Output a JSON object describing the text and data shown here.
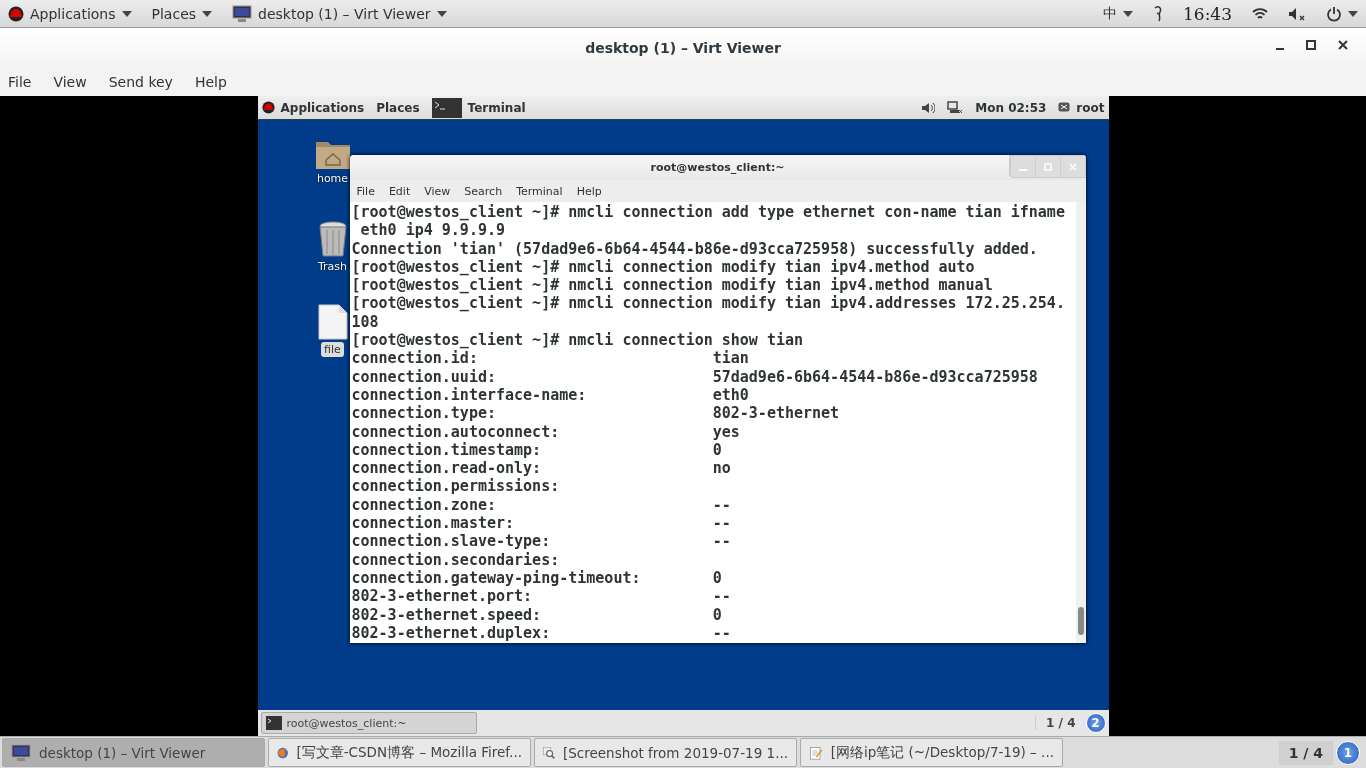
{
  "host_top_bar": {
    "applications": "Applications",
    "places": "Places",
    "active_app": "desktop (1) – Virt Viewer",
    "input_method": "中",
    "clock": "16:43"
  },
  "window": {
    "title": "desktop (1) – Virt Viewer",
    "menu": [
      "File",
      "View",
      "Send key",
      "Help"
    ]
  },
  "guest": {
    "top_bar": {
      "applications": "Applications",
      "places": "Places",
      "active_app": "Terminal",
      "clock": "Mon 02:53",
      "user": "root"
    },
    "desktop_icons": [
      {
        "kind": "folder",
        "label": "home"
      },
      {
        "kind": "trash",
        "label": "Trash"
      },
      {
        "kind": "file",
        "label": "file"
      }
    ],
    "terminal": {
      "title": "root@westos_client:~",
      "menu": [
        "File",
        "Edit",
        "View",
        "Search",
        "Terminal",
        "Help"
      ],
      "lines": [
        {
          "kind": "text",
          "text": "[root@westos_client ~]# nmcli connection add type ethernet con-name tian ifname"
        },
        {
          "kind": "wrap",
          "text": "eth0 ip4 9.9.9.9"
        },
        {
          "kind": "text",
          "text": "Connection 'tian' (57dad9e6-6b64-4544-b86e-d93cca725958) successfully added."
        },
        {
          "kind": "text",
          "text": "[root@westos_client ~]# nmcli connection modify tian ipv4.method auto"
        },
        {
          "kind": "text",
          "text": "[root@westos_client ~]# nmcli connection modify tian ipv4.method manual"
        },
        {
          "kind": "text",
          "text": "[root@westos_client ~]# nmcli connection modify tian ipv4.addresses 172.25.254."
        },
        {
          "kind": "text",
          "text": "108"
        },
        {
          "kind": "text",
          "text": "[root@westos_client ~]# nmcli connection show tian"
        },
        {
          "kind": "field",
          "key": "connection.id:",
          "value": "tian"
        },
        {
          "kind": "field",
          "key": "connection.uuid:",
          "value": "57dad9e6-6b64-4544-b86e-d93cca725958"
        },
        {
          "kind": "field",
          "key": "connection.interface-name:",
          "value": "eth0"
        },
        {
          "kind": "field",
          "key": "connection.type:",
          "value": "802-3-ethernet"
        },
        {
          "kind": "field",
          "key": "connection.autoconnect:",
          "value": "yes"
        },
        {
          "kind": "field",
          "key": "connection.timestamp:",
          "value": "0"
        },
        {
          "kind": "field",
          "key": "connection.read-only:",
          "value": "no"
        },
        {
          "kind": "field",
          "key": "connection.permissions:"
        },
        {
          "kind": "field",
          "key": "connection.zone:",
          "value": "--"
        },
        {
          "kind": "field",
          "key": "connection.master:",
          "value": "--"
        },
        {
          "kind": "field",
          "key": "connection.slave-type:",
          "value": "--"
        },
        {
          "kind": "field",
          "key": "connection.secondaries:"
        },
        {
          "kind": "field",
          "key": "connection.gateway-ping-timeout:",
          "value": "0"
        },
        {
          "kind": "field",
          "key": "802-3-ethernet.port:",
          "value": "--"
        },
        {
          "kind": "field",
          "key": "802-3-ethernet.speed:",
          "value": "0"
        },
        {
          "kind": "field",
          "key": "802-3-ethernet.duplex:",
          "value": "--"
        }
      ]
    },
    "bottom_bar": {
      "tasks": [
        {
          "label": "root@westos_client:~",
          "selected": false
        }
      ],
      "workspace": "1 / 4",
      "badge": "2"
    }
  },
  "taskbar": {
    "tasks": [
      {
        "kind": "monitor",
        "label": "desktop (1) – Virt Viewer",
        "selected": true
      },
      {
        "kind": "browser",
        "label": "[写文章-CSDN博客 – Mozilla Firef...",
        "selected": false
      },
      {
        "kind": "viewer",
        "label": "[Screenshot from 2019-07-19 1...",
        "selected": false
      },
      {
        "kind": "editor",
        "label": "[网络ip笔记 (~/Desktop/7-19) – ...",
        "selected": false
      }
    ],
    "workspace": "1 / 4",
    "badge": "1"
  }
}
